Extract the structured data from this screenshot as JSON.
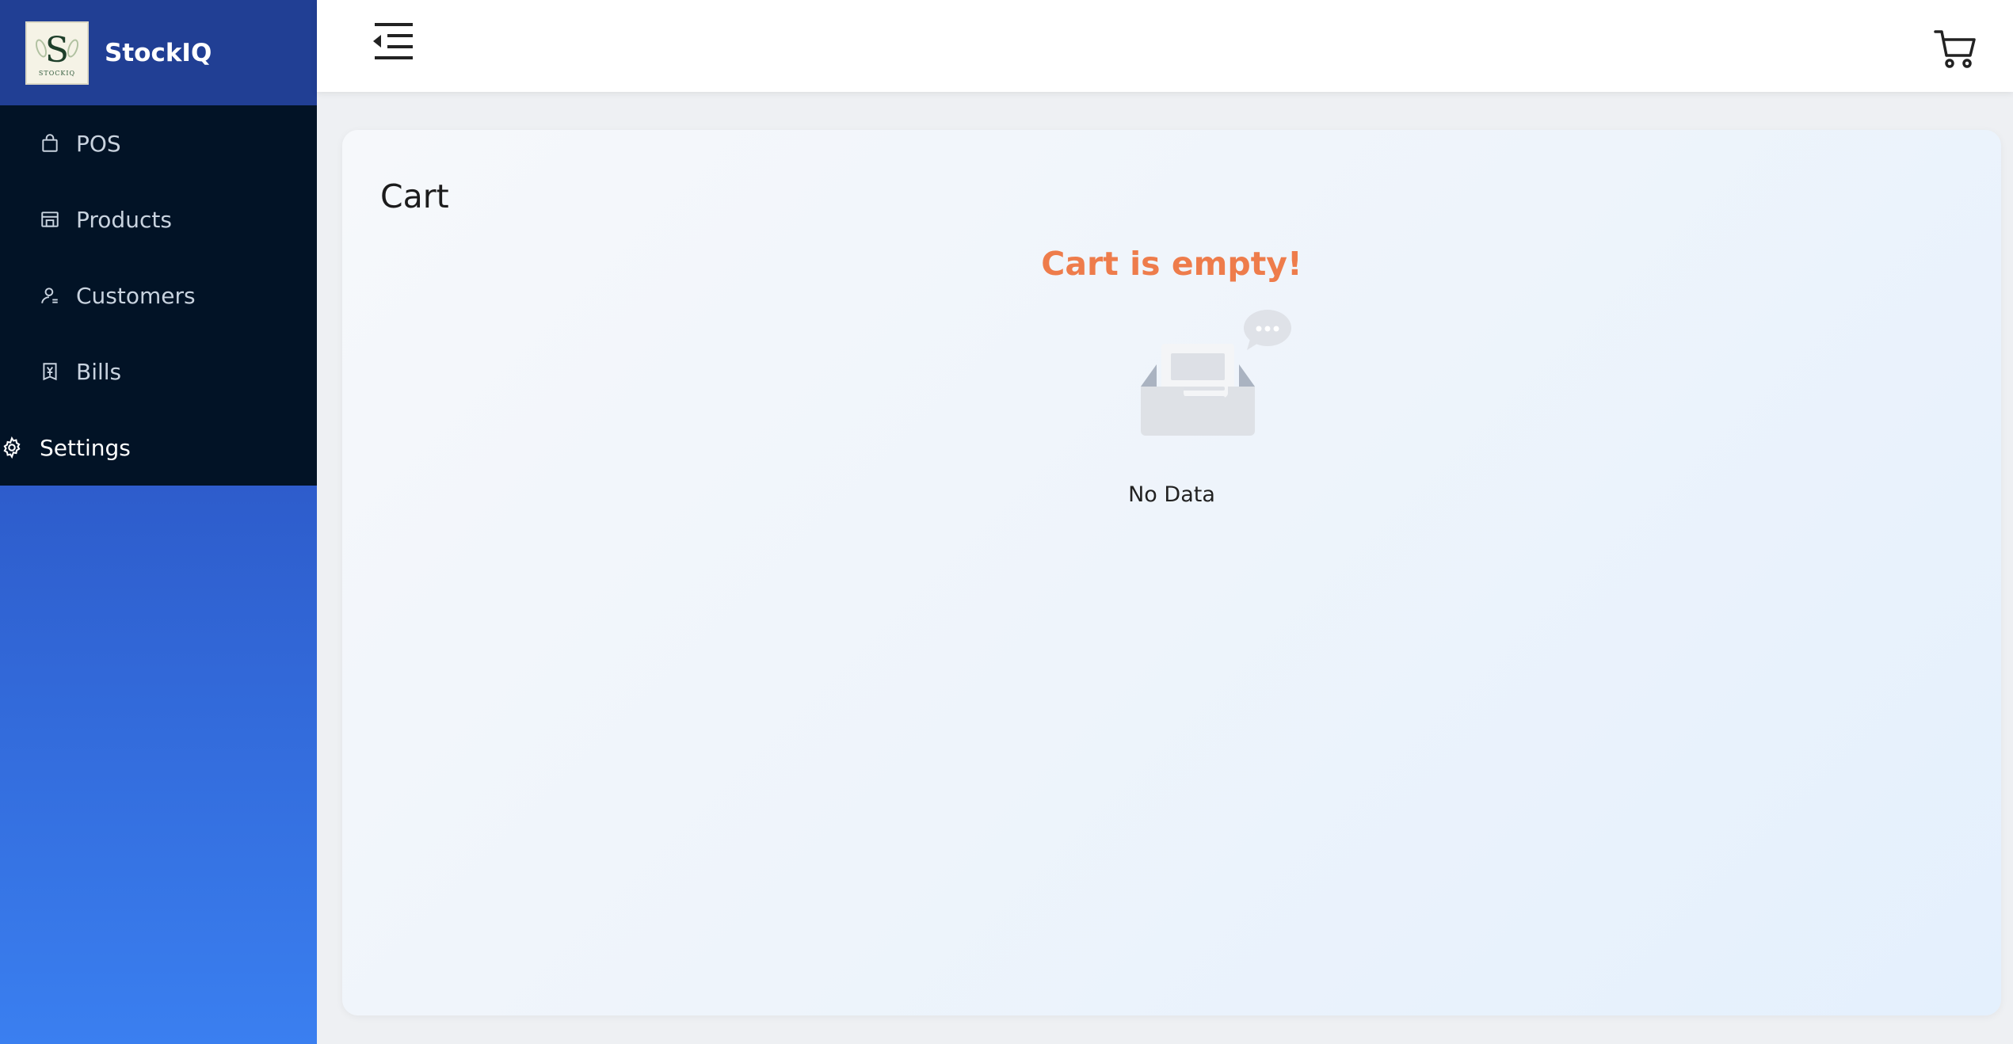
{
  "app": {
    "title": "StockIQ",
    "logo_letter": "S",
    "logo_caption": "STOCKIQ"
  },
  "sidebar": {
    "items": [
      {
        "label": "POS",
        "icon": "shopping-bag-icon"
      },
      {
        "label": "Products",
        "icon": "store-icon"
      },
      {
        "label": "Customers",
        "icon": "user-icon"
      },
      {
        "label": "Bills",
        "icon": "bill-icon"
      },
      {
        "label": "Settings",
        "icon": "gear-icon"
      }
    ]
  },
  "header": {
    "toggle_icon": "menu-fold-icon",
    "cart_icon": "cart-icon"
  },
  "main": {
    "title": "Cart",
    "empty_heading": "Cart is empty!",
    "empty_text": "No Data",
    "accent_color": "#ee7c4b"
  }
}
